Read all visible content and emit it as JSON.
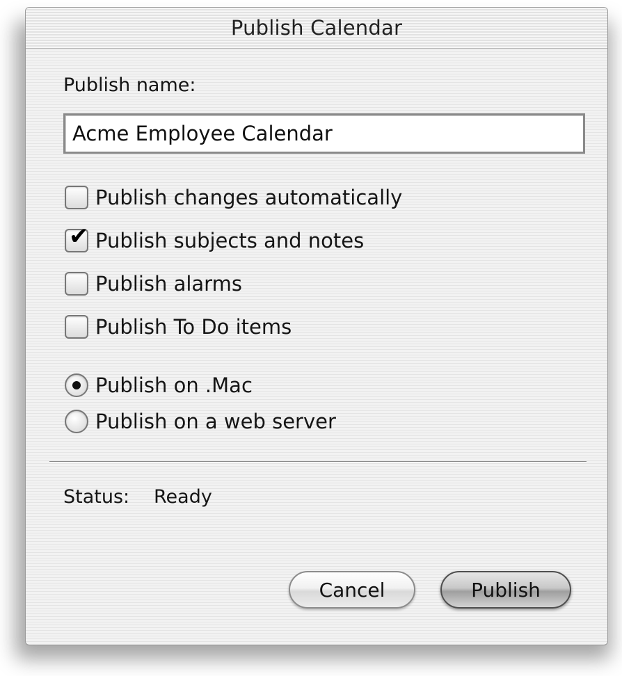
{
  "window": {
    "title": "Publish Calendar"
  },
  "form": {
    "name_label": "Publish name:",
    "name_value": "Acme Employee Calendar",
    "options": [
      {
        "label": "Publish changes automatically",
        "checked": false
      },
      {
        "label": "Publish subjects and notes",
        "checked": true
      },
      {
        "label": "Publish alarms",
        "checked": false
      },
      {
        "label": "Publish To Do items",
        "checked": false
      }
    ],
    "destinations": [
      {
        "label": "Publish on .Mac",
        "selected": true
      },
      {
        "label": "Publish on a web server",
        "selected": false
      }
    ]
  },
  "status": {
    "label": "Status:",
    "value": "Ready"
  },
  "buttons": {
    "cancel": "Cancel",
    "publish": "Publish"
  },
  "icons": {
    "checkmark": "checkmark-icon",
    "radio_dot": "radio-selected-icon"
  }
}
